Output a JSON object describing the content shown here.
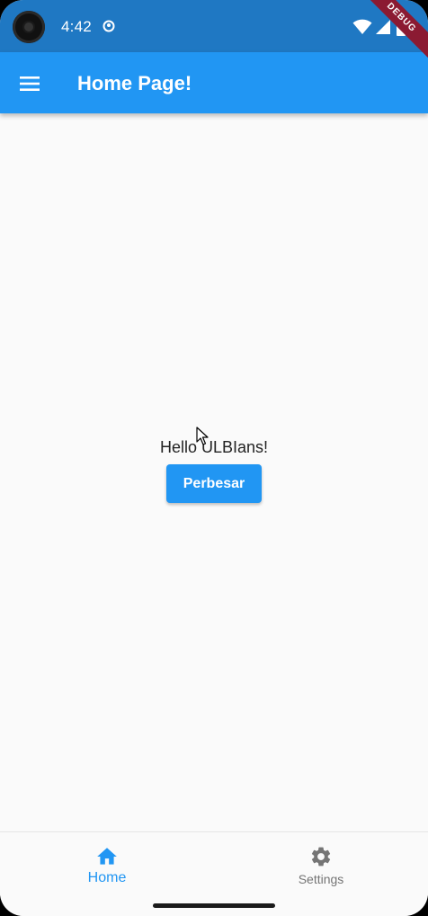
{
  "status_bar": {
    "time": "4:42",
    "icons": [
      "camera-cutout",
      "sync-indicator-icon",
      "wifi-icon",
      "signal-icon",
      "battery-icon"
    ]
  },
  "debug_banner": "DEBUG",
  "app_bar": {
    "title": "Home Page!",
    "menu_icon": "menu-icon"
  },
  "body": {
    "greeting": "Hello ULBIans!",
    "button_label": "Perbesar"
  },
  "bottom_nav": {
    "items": [
      {
        "label": "Home",
        "icon": "home-icon",
        "active": true
      },
      {
        "label": "Settings",
        "icon": "settings-icon",
        "active": false
      }
    ]
  },
  "colors": {
    "primary": "#2196f3",
    "status_bar": "#1f78c3",
    "background": "#fafafa",
    "inactive": "#757575",
    "debug": "#8b1a32"
  }
}
